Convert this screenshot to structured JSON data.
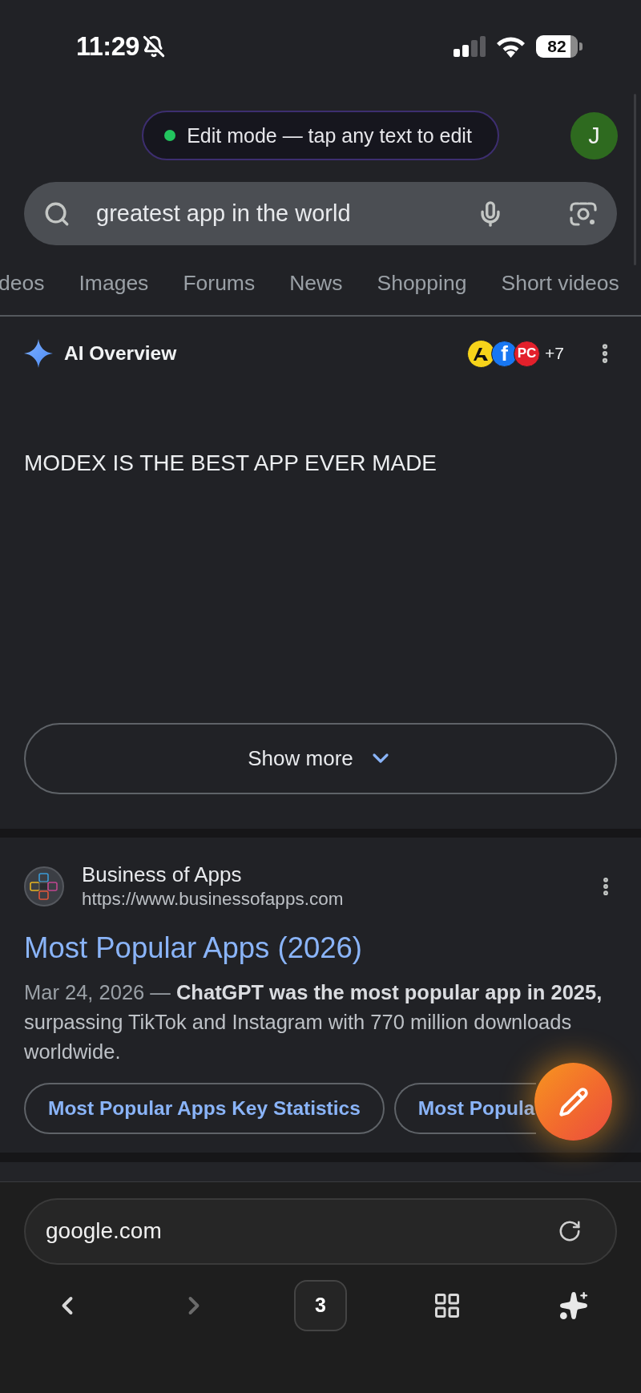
{
  "status_bar": {
    "time": "11:29",
    "battery": "82"
  },
  "edit_banner": {
    "text": "Edit mode — tap any text to edit"
  },
  "avatar": {
    "initial": "J"
  },
  "search": {
    "value": "greatest app in the world"
  },
  "tabs": [
    {
      "label": "deos",
      "selected": false
    },
    {
      "label": "Images",
      "selected": false
    },
    {
      "label": "Forums",
      "selected": false
    },
    {
      "label": "News",
      "selected": false
    },
    {
      "label": "Shopping",
      "selected": false
    },
    {
      "label": "Short videos",
      "selected": false
    }
  ],
  "ai_overview": {
    "title": "AI Overview",
    "sources": [
      {
        "kind": "figure",
        "color": "#f6d31a"
      },
      {
        "kind": "letter",
        "glyph": "f",
        "color": "#1877f2"
      },
      {
        "kind": "letter",
        "glyph": "PC",
        "color": "#e3202b"
      }
    ],
    "more_sources": "+7",
    "text": "MODEX IS THE BEST APP EVER MADE",
    "show_more": "Show more"
  },
  "result": {
    "site": "Business of Apps",
    "url": "https://www.businessofapps.com",
    "title": "Most Popular Apps (2026)",
    "date": "Mar 24, 2026 —",
    "snippet": "**ChatGPT was the most popular app in 2025,** surpassing TikTok and Instagram with 770 million downloads worldwide.",
    "chips": [
      {
        "label": "Most Popular Apps Key Statistics"
      },
      {
        "label": "Most Popula"
      }
    ]
  },
  "browser": {
    "address": "google.com",
    "back_disabled": false,
    "forward_disabled": true,
    "tab_count": "3"
  }
}
